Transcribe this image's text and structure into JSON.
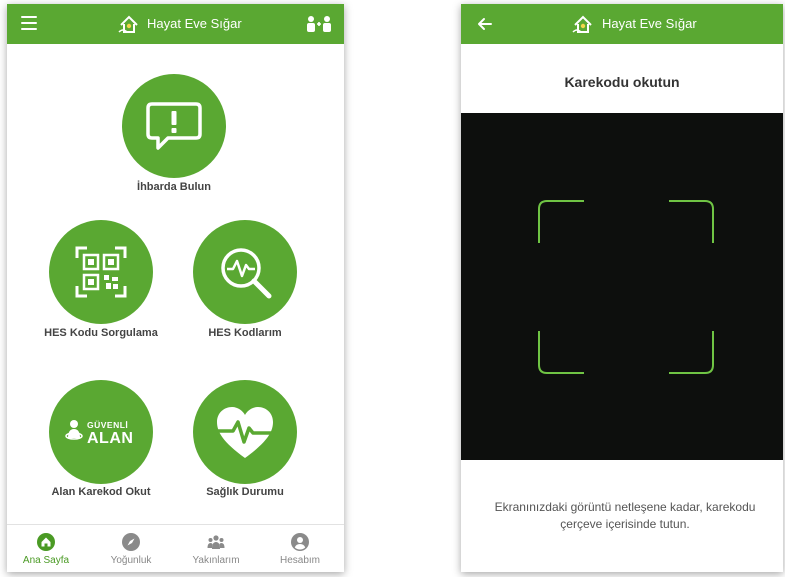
{
  "app": {
    "title": "Hayat Eve Sığar"
  },
  "home": {
    "tiles": [
      {
        "label": "İhbarda Bulun"
      },
      {
        "label": "HES Kodu Sorgulama"
      },
      {
        "label": "HES Kodlarım"
      },
      {
        "label": "Alan Karekod Okut",
        "badge_line1": "GÜVENLİ",
        "badge_line2": "ALAN"
      },
      {
        "label": "Sağlık Durumu"
      }
    ],
    "bottom_nav": [
      {
        "label": "Ana Sayfa",
        "icon": "home-icon",
        "active": true
      },
      {
        "label": "Yoğunluk",
        "icon": "compass-icon",
        "active": false
      },
      {
        "label": "Yakınlarım",
        "icon": "group-icon",
        "active": false
      },
      {
        "label": "Hesabım",
        "icon": "account-icon",
        "active": false
      }
    ]
  },
  "scanner": {
    "heading": "Karekodu okutun",
    "hint": "Ekranınızdaki görüntü netleşene kadar, karekodu çerçeve içerisinde tutun."
  },
  "colors": {
    "brand_green": "#5aa832",
    "active_nav": "#4a9a24",
    "camera_bg": "#0d0f0d",
    "scan_frame": "#6fc444"
  }
}
